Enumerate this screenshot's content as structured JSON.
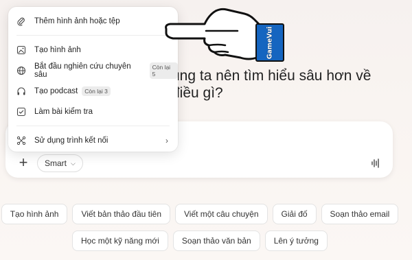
{
  "heading": {
    "line1": "úng ta nên tìm hiểu sâu hơn về",
    "line2": "điều gì?"
  },
  "menu": {
    "attach_label": "Thêm hình ảnh hoặc tệp",
    "create_image_label": "Tạo hình ảnh",
    "deep_research_label": "Bắt đầu nghiên cứu chuyên sâu",
    "deep_research_badge": "Còn lại 5",
    "podcast_label": "Tạo podcast",
    "podcast_badge": "Còn lại 3",
    "quiz_label": "Làm bài kiểm tra",
    "connectors_label": "Sử dụng trình kết nối"
  },
  "composer": {
    "plus_label": "+",
    "mode_label": "Smart"
  },
  "chips": {
    "row1": [
      "Tạo hình ảnh",
      "Viết bản thảo đầu tiên",
      "Viết một câu chuyện",
      "Giải đố",
      "Soạn thảo email"
    ],
    "row2": [
      "Học một kỹ năng mới",
      "Soạn thảo văn bản",
      "Lên ý tưởng"
    ]
  },
  "logo": {
    "text": "GameVui"
  },
  "colors": {
    "logo_bg": "#1565c0",
    "page_bg": "#f7f2ef"
  }
}
